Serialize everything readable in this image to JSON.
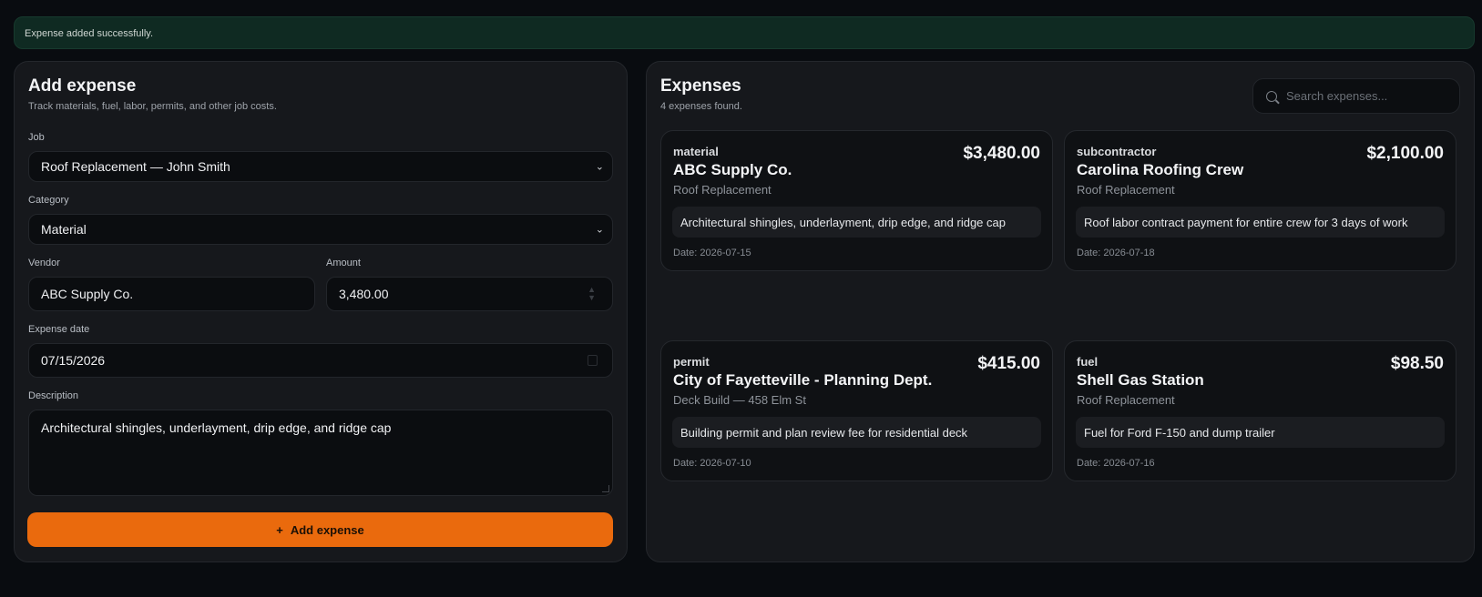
{
  "toast": {
    "message": "Expense added successfully.",
    "color": "#0f2a22"
  },
  "form": {
    "title": "Add expense",
    "subtitle": "Track materials, fuel, labor, permits, and other job costs.",
    "job": {
      "label": "Job",
      "value": "Roof Replacement — John Smith"
    },
    "category": {
      "label": "Category",
      "value": "Material"
    },
    "vendor": {
      "label": "Vendor",
      "value": "ABC Supply Co."
    },
    "amount": {
      "label": "Amount",
      "value": "3,480.00"
    },
    "date": {
      "label": "Expense date",
      "value": "07/15/2026"
    },
    "description": {
      "label": "Description",
      "value": "Architectural shingles, underlayment, drip edge, and ridge cap"
    },
    "submit": {
      "label": "Add expense",
      "icon": "plus-icon",
      "color": "#ea6a0d"
    }
  },
  "expenses": {
    "title": "Expenses",
    "count_text": "4 expenses found.",
    "search_placeholder": "Search expenses...",
    "items": [
      {
        "category": "material",
        "amount": "$3,480.00",
        "vendor": "ABC Supply Co.",
        "job": "Roof Replacement",
        "description": "Architectural shingles, underlayment, drip edge, and ridge cap",
        "date": "Date: 2026-07-15"
      },
      {
        "category": "subcontractor",
        "amount": "$2,100.00",
        "vendor": "Carolina Roofing Crew",
        "job": "Roof Replacement",
        "description": "Roof labor contract payment for entire crew for 3 days of work",
        "date": "Date: 2026-07-18"
      },
      {
        "category": "permit",
        "amount": "$415.00",
        "vendor": "City of Fayetteville - Planning Dept.",
        "job": "Deck Build — 458 Elm St",
        "description": "Building permit and plan review fee for residential deck",
        "date": "Date: 2026-07-10"
      },
      {
        "category": "fuel",
        "amount": "$98.50",
        "vendor": "Shell Gas Station",
        "job": "Roof Replacement",
        "description": "Fuel for Ford F-150 and dump trailer",
        "date": "Date: 2026-07-16"
      }
    ]
  }
}
